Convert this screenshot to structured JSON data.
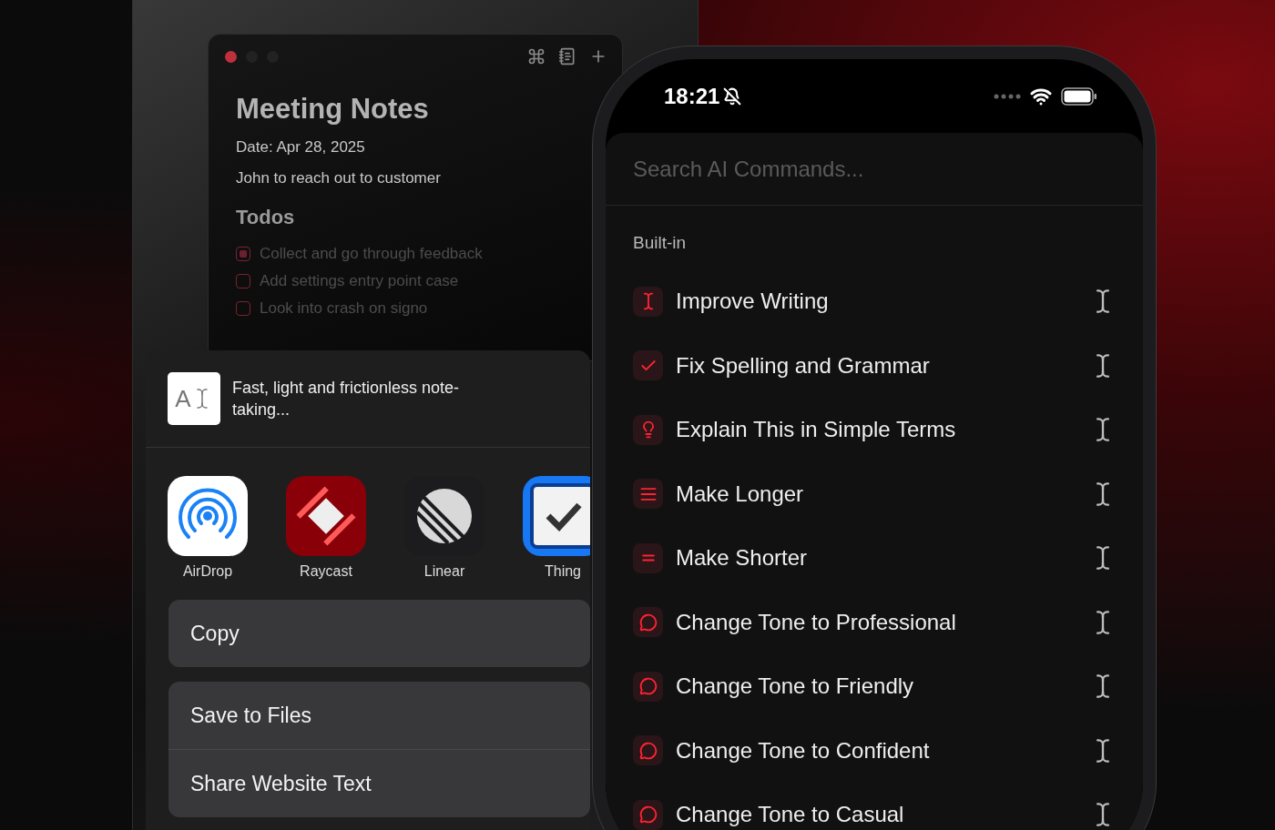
{
  "notes_window": {
    "title": "Meeting Notes",
    "lines": [
      "Date: Apr 28, 2025",
      "John to reach out to customer"
    ],
    "section": "Todos",
    "todos": [
      {
        "text": "Collect and go through feedback",
        "checked": true
      },
      {
        "text": "Add settings entry point case",
        "checked": false
      },
      {
        "text": "Look into crash on signo",
        "checked": false
      }
    ]
  },
  "share_sheet": {
    "preview": {
      "icon_text": "A",
      "text": "Fast, light and frictionless note-taking..."
    },
    "apps": [
      {
        "label": "AirDrop",
        "kind": "airdrop"
      },
      {
        "label": "Raycast",
        "kind": "raycast"
      },
      {
        "label": "Linear",
        "kind": "linear"
      },
      {
        "label": "Thing",
        "kind": "things"
      }
    ],
    "action_groups": [
      [
        "Copy"
      ],
      [
        "Save to Files",
        "Share Website Text"
      ]
    ]
  },
  "phone": {
    "status_bar": {
      "time": "18:21"
    },
    "search": {
      "placeholder": "Search AI Commands..."
    },
    "section": "Built-in",
    "commands": [
      {
        "label": "Improve Writing",
        "kind": "cursor"
      },
      {
        "label": "Fix Spelling and Grammar",
        "kind": "check"
      },
      {
        "label": "Explain This in Simple Terms",
        "kind": "bulb"
      },
      {
        "label": "Make Longer",
        "kind": "longer"
      },
      {
        "label": "Make Shorter",
        "kind": "shorter"
      },
      {
        "label": "Change Tone to Professional",
        "kind": "tone"
      },
      {
        "label": "Change Tone to Friendly",
        "kind": "tone"
      },
      {
        "label": "Change Tone to Confident",
        "kind": "tone"
      },
      {
        "label": "Change Tone to Casual",
        "kind": "tone"
      }
    ]
  }
}
